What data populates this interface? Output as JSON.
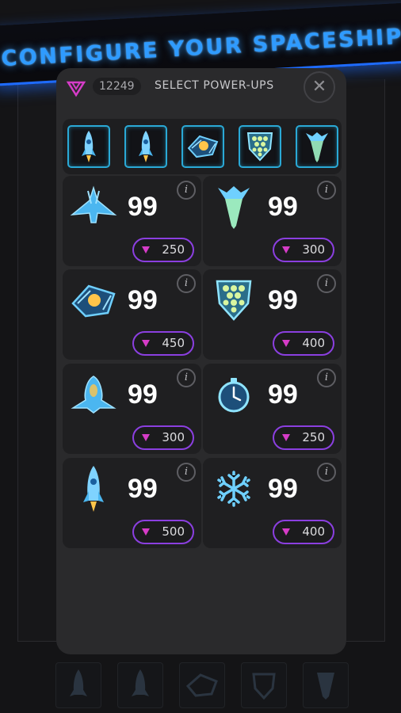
{
  "banner": {
    "title": "CONFIGURE YOUR SPACESHIP"
  },
  "header": {
    "gem_count": "12249",
    "select_label": "SELECT POWER-UPS",
    "close_symbol": "✕"
  },
  "colors": {
    "accent_blue": "#2f9bff",
    "gem_magenta": "#d63cc8",
    "price_border": "#8b3fe0",
    "slot_border": "#2aa9d6"
  },
  "selected_slots": [
    {
      "icon": "rocket-icon"
    },
    {
      "icon": "rocket-icon"
    },
    {
      "icon": "satellite-drone-icon"
    },
    {
      "icon": "shield-icon"
    },
    {
      "icon": "plasma-beam-icon"
    }
  ],
  "powerups": [
    {
      "icon": "fighter-ship-icon",
      "count": "99",
      "price": "250",
      "info": "i"
    },
    {
      "icon": "plasma-beam-icon",
      "count": "99",
      "price": "300",
      "info": "i"
    },
    {
      "icon": "satellite-drone-icon",
      "count": "99",
      "price": "450",
      "info": "i"
    },
    {
      "icon": "shield-icon",
      "count": "99",
      "price": "400",
      "info": "i"
    },
    {
      "icon": "scout-ship-icon",
      "count": "99",
      "price": "300",
      "info": "i"
    },
    {
      "icon": "stopwatch-icon",
      "count": "99",
      "price": "250",
      "info": "i"
    },
    {
      "icon": "rocket-icon",
      "count": "99",
      "price": "500",
      "info": "i"
    },
    {
      "icon": "snowflake-icon",
      "count": "99",
      "price": "400",
      "info": "i"
    }
  ]
}
